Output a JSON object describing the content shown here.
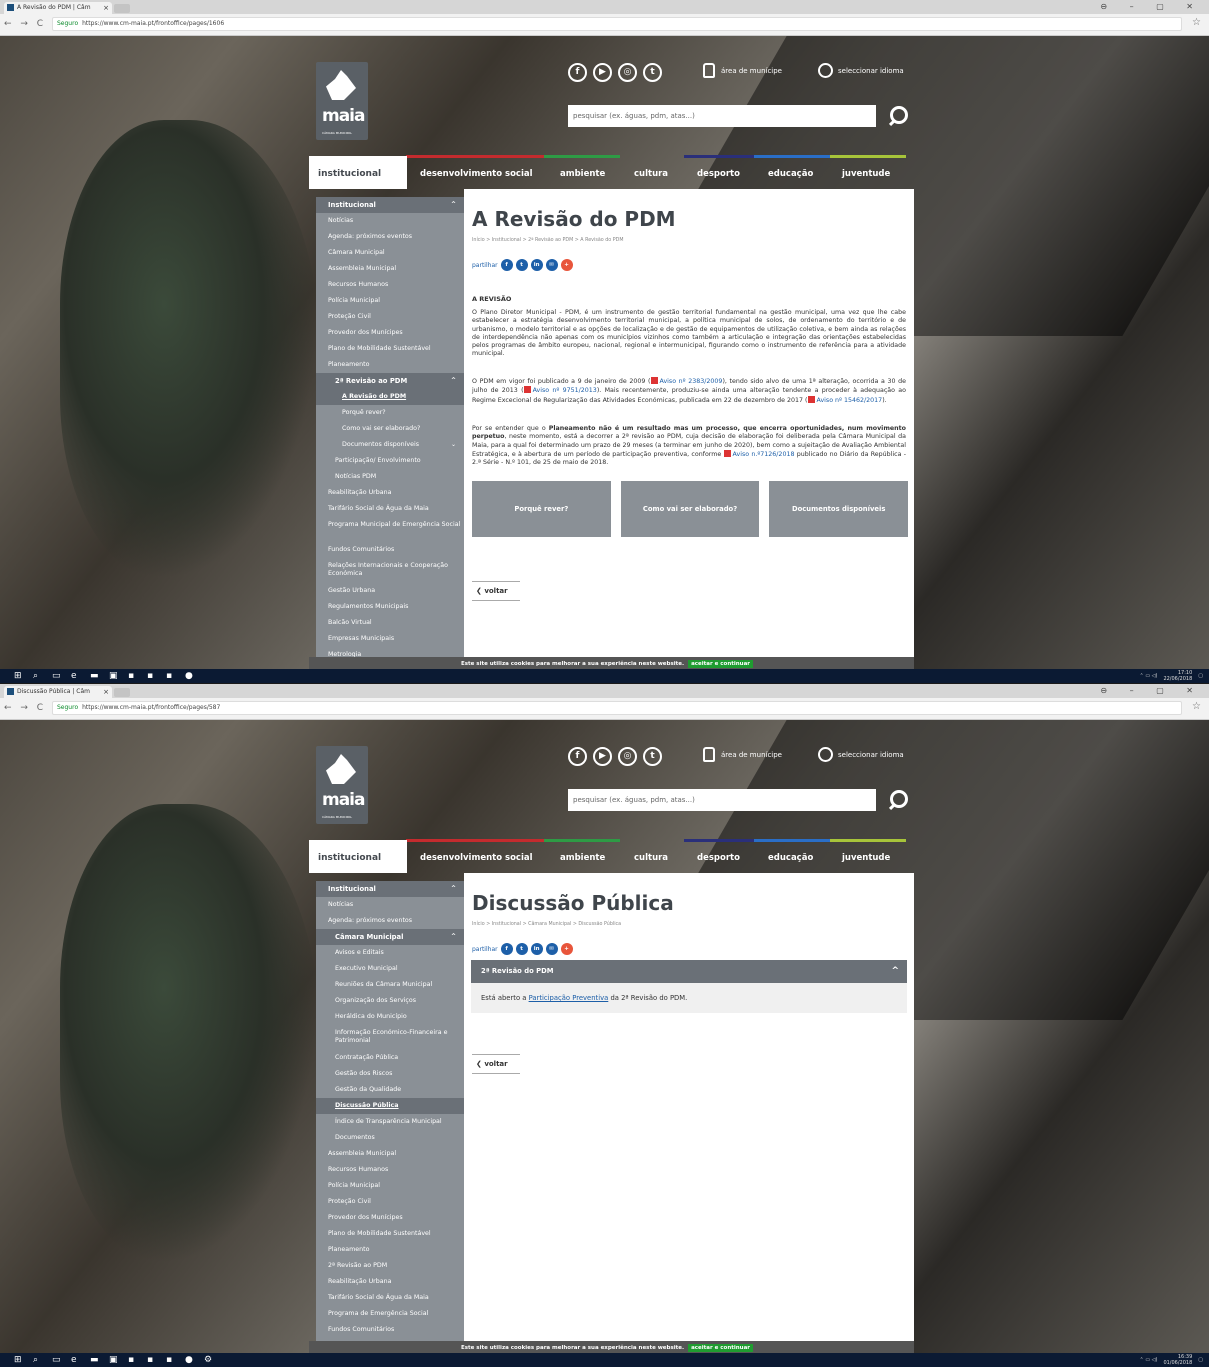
{
  "shot1": {
    "tab_title": "A Revisão do PDM | Câm",
    "security": "Seguro",
    "url": "https://www.cm-maia.pt/frontoffice/pages/1606",
    "page_title": "A Revisão do PDM",
    "breadcrumb": "Início  >  Institucional  >  2ª Revisão ao PDM  >  A Revisão do PDM",
    "section_heading": "A REVISÃO",
    "para1": "O Plano Diretor Municipal - PDM, é um instrumento de gestão territorial fundamental na gestão municipal, uma vez que lhe cabe estabelecer a estratégia desenvolvimento territorial municipal, a política municipal de solos, de ordenamento do território e de urbanismo, o modelo territorial e as opções de localização e de gestão de equipamentos de utilização coletiva, e bem ainda as relações de interdependência não apenas com os municípios vizinhos como também a articulação e integração das orientações estabelecidas pelos programas de âmbito europeu, nacional, regional e intermunicipal, figurando como o instrumento de referência para a atividade municipal.",
    "para2_a": "O PDM em vigor foi publicado a 9 de janeiro de 2009 (",
    "para2_link1": "Aviso nº 2383/2009",
    "para2_b": "), tendo sido alvo de uma 1ª alteração, ocorrida a 30 de julho de 2013 (",
    "para2_link2": "Aviso nº 9751/2013",
    "para2_c": "). Mais recentemente, produziu-se ainda uma alteração tendente a proceder à adequação ao Regime Excecional de Regularização das Atividades Económicas, publicada em 22 de dezembro de 2017 (",
    "para2_link3": "Aviso nº 15462/2017",
    "para2_d": ").",
    "para3_a": "Por se entender que o ",
    "para3_bold": "Planeamento não é um resultado mas um processo, que encerra oportunidades, num movimento perpetuo",
    "para3_b": ", neste momento, está a decorrer a 2ª revisão ao PDM, cuja decisão de elaboração foi deliberada pela Câmara Municipal da Maia, para a qual foi determinado um prazo de 29 meses (a terminar em junho de 2020), bem como a sujeitação de Avaliação Ambiental Estratégica, e à abertura de um período de participação preventiva, conforme ",
    "para3_link": "Aviso n.º7126/2018",
    "para3_c": " publicado no Diário da República - 2.ª Série - N.º 101, de 25 de maio de 2018.",
    "boxes": [
      "Porquê rever?",
      "Como vai ser elaborado?",
      "Documentos disponíveis"
    ],
    "sidebar": [
      {
        "label": "Institucional",
        "cls": "hdr",
        "car": "^"
      },
      {
        "label": "Notícias",
        "cls": ""
      },
      {
        "label": "Agenda: próximos eventos",
        "cls": ""
      },
      {
        "label": "Câmara Municipal",
        "cls": ""
      },
      {
        "label": "Assembleia Municipal",
        "cls": ""
      },
      {
        "label": "Recursos Humanos",
        "cls": ""
      },
      {
        "label": "Polícia Municipal",
        "cls": ""
      },
      {
        "label": "Proteção Civil",
        "cls": ""
      },
      {
        "label": "Provedor dos Munícipes",
        "cls": ""
      },
      {
        "label": "Plano de Mobilidade Sustentável",
        "cls": ""
      },
      {
        "label": "Planeamento",
        "cls": ""
      },
      {
        "label": "2ª Revisão ao PDM",
        "cls": "hdr l1",
        "car": "^"
      },
      {
        "label": "A Revisão do PDM",
        "cls": "sel l2"
      },
      {
        "label": "Porquê rever?",
        "cls": "l2"
      },
      {
        "label": "Como vai ser elaborado?",
        "cls": "l2"
      },
      {
        "label": "Documentos disponíveis",
        "cls": "l2",
        "car": "v"
      },
      {
        "label": "Participação/ Envolvimento",
        "cls": "l1"
      },
      {
        "label": "Notícias PDM",
        "cls": "l1"
      },
      {
        "label": "Reabilitação Urbana",
        "cls": ""
      },
      {
        "label": "Tarifário Social de Água da Maia",
        "cls": ""
      },
      {
        "label": "Programa Municipal de Emergência Social",
        "cls": "tall"
      },
      {
        "label": "Fundos Comunitários",
        "cls": ""
      },
      {
        "label": "Relações Internacionais e Cooperação Económica",
        "cls": "tall"
      },
      {
        "label": "Gestão Urbana",
        "cls": ""
      },
      {
        "label": "Regulamentos Municipais",
        "cls": ""
      },
      {
        "label": "Balcão Virtual",
        "cls": ""
      },
      {
        "label": "Empresas Municipais",
        "cls": ""
      },
      {
        "label": "Metrologia",
        "cls": ""
      }
    ],
    "time": "17:10",
    "date": "22/06/2018"
  },
  "shot2": {
    "tab_title": "Discussão Pública | Câm",
    "security": "Seguro",
    "url": "https://www.cm-maia.pt/frontoffice/pages/587",
    "page_title": "Discussão Pública",
    "breadcrumb": "Início  >  Institucional  >  Câmara Municipal  >  Discussão Pública",
    "accordion_title": "2ª Revisão do PDM",
    "accordion_text_a": "Está aberto a ",
    "accordion_link": "Participação Preventiva",
    "accordion_text_b": " da 2ª Revisão do PDM.",
    "sidebar": [
      {
        "label": "Institucional",
        "cls": "hdr",
        "car": "^"
      },
      {
        "label": "Notícias",
        "cls": ""
      },
      {
        "label": "Agenda: próximos eventos",
        "cls": ""
      },
      {
        "label": "Câmara Municipal",
        "cls": "hdr l1",
        "car": "^"
      },
      {
        "label": "Avisos e Editais",
        "cls": "l1"
      },
      {
        "label": "Executivo Municipal",
        "cls": "l1"
      },
      {
        "label": "Reuniões da Câmara Municipal",
        "cls": "l1"
      },
      {
        "label": "Organização dos Serviços",
        "cls": "l1"
      },
      {
        "label": "Heráldica do Município",
        "cls": "l1"
      },
      {
        "label": "Informação Económico-Financeira e Patrimonial",
        "cls": "l1 tall"
      },
      {
        "label": "Contratação Pública",
        "cls": "l1"
      },
      {
        "label": "Gestão dos Riscos",
        "cls": "l1"
      },
      {
        "label": "Gestão da Qualidade",
        "cls": "l1"
      },
      {
        "label": "Discussão Pública",
        "cls": "sel l1"
      },
      {
        "label": "Índice de Transparência Municipal",
        "cls": "l1"
      },
      {
        "label": "Documentos",
        "cls": "l1"
      },
      {
        "label": "Assembleia Municipal",
        "cls": ""
      },
      {
        "label": "Recursos Humanos",
        "cls": ""
      },
      {
        "label": "Polícia Municipal",
        "cls": ""
      },
      {
        "label": "Proteção Civil",
        "cls": ""
      },
      {
        "label": "Provedor dos Munícipes",
        "cls": ""
      },
      {
        "label": "Plano de Mobilidade Sustentável",
        "cls": ""
      },
      {
        "label": "Planeamento",
        "cls": ""
      },
      {
        "label": "2ª Revisão ao PDM",
        "cls": ""
      },
      {
        "label": "Reabilitação Urbana",
        "cls": ""
      },
      {
        "label": "Tarifário Social de Água da Maia",
        "cls": ""
      },
      {
        "label": "Programa de Emergência Social",
        "cls": ""
      },
      {
        "label": "Fundos Comunitários",
        "cls": ""
      },
      {
        "label": "Relações Internacionais e",
        "cls": ""
      }
    ],
    "time": "16:39",
    "date": "01/06/2018"
  },
  "common": {
    "logo": "maia",
    "logo_sub": "CÂMARA MUNICIPAL",
    "area_label": "área de munícipe",
    "lang_label": "seleccionar idioma",
    "search_placeholder": "pesquisar (ex. águas, pdm, atas...)",
    "share_label": "partilhar",
    "voltar": "voltar",
    "cookie_text": "Este site utiliza cookies para melhorar a sua experiência neste website.",
    "cookie_button": "aceitar e continuar",
    "menu": [
      "institucional",
      "desenvolvimento social",
      "ambiente",
      "cultura",
      "desporto",
      "educação",
      "juventude"
    ],
    "colors": {
      "accent_blue": "#1d5fa8",
      "sidebar": "#8a9096",
      "sidebar_dark": "#6a7077",
      "line_red": "#c42b2e",
      "line_green": "#2e9b45",
      "line_navy": "#2a2f7a",
      "line_blue": "#2a6ec7",
      "line_lime": "#a7c43a"
    }
  }
}
